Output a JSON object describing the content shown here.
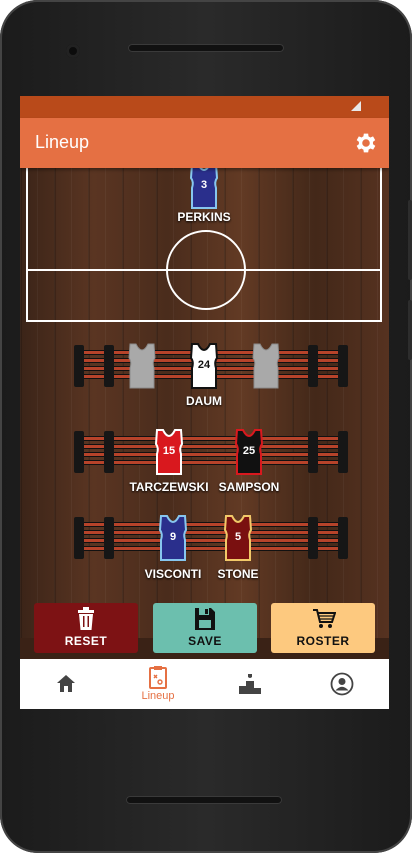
{
  "app": {
    "title": "Lineup"
  },
  "court_player": {
    "name": "PERKINS",
    "number": "3"
  },
  "bench_rows": [
    {
      "players": [
        {
          "name": "",
          "number": ""
        },
        {
          "name": "DAUM",
          "number": "24"
        },
        {
          "name": "",
          "number": ""
        }
      ]
    },
    {
      "players": [
        {
          "name": "TARCZEWSKI",
          "number": "15"
        },
        {
          "name": "SAMPSON",
          "number": "25"
        }
      ]
    },
    {
      "players": [
        {
          "name": "VISCONTI",
          "number": "9"
        },
        {
          "name": "STONE",
          "number": "5"
        }
      ]
    }
  ],
  "actions": {
    "reset": "RESET",
    "save": "SAVE",
    "roster": "ROSTER"
  },
  "nav": {
    "lineup": "Lineup"
  },
  "colors": {
    "accent": "#e57043",
    "status_bar": "#b94a1a",
    "reset": "#7d1214",
    "save": "#6cbfae",
    "roster": "#fdc97f"
  },
  "icons": [
    "gear-icon",
    "trash-icon",
    "floppy-icon",
    "cart-icon",
    "home-icon",
    "clipboard-icon",
    "podium-icon",
    "profile-icon",
    "back-icon"
  ]
}
